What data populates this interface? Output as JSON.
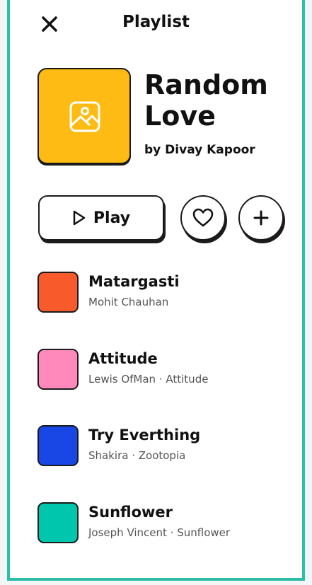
{
  "header": {
    "title": "Playlist"
  },
  "playlist": {
    "title": "Random Love",
    "byline": "by Divay Kapoor",
    "cover_color": "#fdbb13"
  },
  "actions": {
    "play_label": "Play"
  },
  "tracks": [
    {
      "title": "Matargasti",
      "subtitle": "Mohit Chauhan",
      "color": "#f95a2c"
    },
    {
      "title": "Attitude",
      "subtitle": "Lewis OfMan · Attitude",
      "color": "#ff89bb"
    },
    {
      "title": "Try Everthing",
      "subtitle": "Shakira · Zootopia",
      "color": "#1947e5"
    },
    {
      "title": "Sunflower",
      "subtitle": "Joseph Vincent · Sunflower",
      "color": "#00c6ae"
    }
  ],
  "colors": {
    "accent_border": "#2bbfa9",
    "ink": "#1b1b1b"
  },
  "icons": {
    "close": "close-icon",
    "cover": "image-icon",
    "play": "play-icon",
    "like": "heart-icon",
    "add": "plus-icon"
  }
}
